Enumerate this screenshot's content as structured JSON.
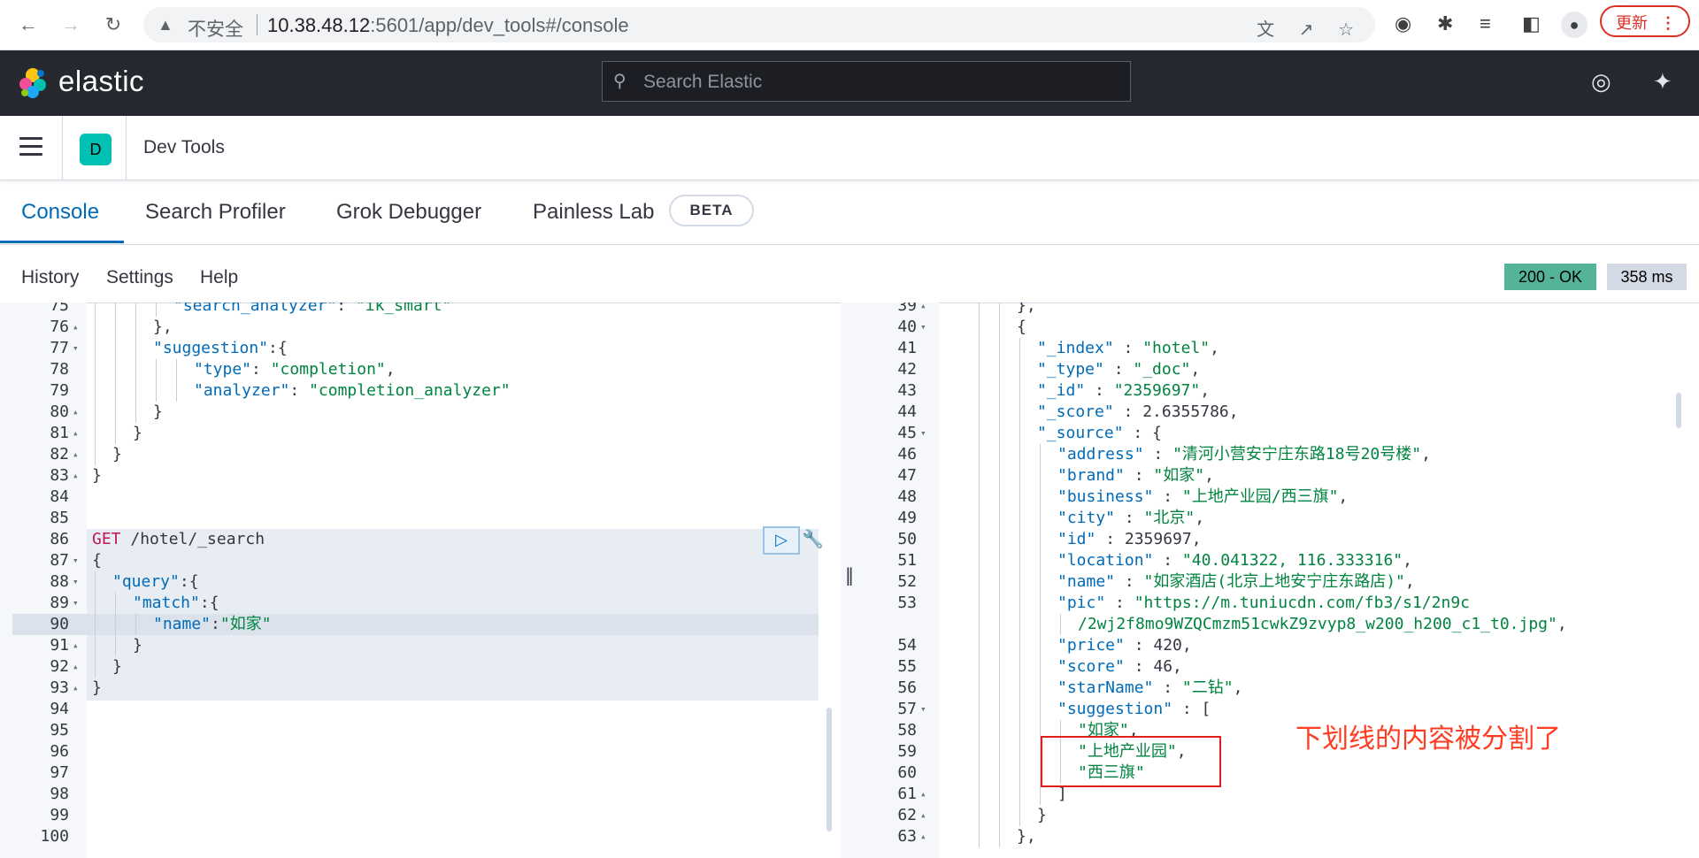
{
  "browser": {
    "insecure_label": "不安全",
    "url_host": "10.38.48.12",
    "url_rest": ":5601/app/dev_tools#/console",
    "update_button": "更新"
  },
  "header": {
    "brand": "elastic",
    "search_placeholder": "Search Elastic"
  },
  "breadcrumb": {
    "avatar_letter": "D",
    "app_title": "Dev Tools"
  },
  "tabs": [
    {
      "label": "Console",
      "active": true
    },
    {
      "label": "Search Profiler"
    },
    {
      "label": "Grok Debugger"
    },
    {
      "label": "Painless Lab"
    }
  ],
  "beta_badge": "BETA",
  "toolbar": {
    "history": "History",
    "settings": "Settings",
    "help": "Help",
    "status": "200 - OK",
    "time": "358 ms"
  },
  "request_editor": {
    "lines": [
      {
        "n": "75",
        "fold": "",
        "indent": 4,
        "parts": [
          [
            "k",
            "\"search_analyzer\""
          ],
          [
            "n",
            ": "
          ],
          [
            "s",
            "\"ik_smart\""
          ]
        ]
      },
      {
        "n": "76",
        "fold": "▴",
        "indent": 3,
        "parts": [
          [
            "n",
            "},"
          ]
        ]
      },
      {
        "n": "77",
        "fold": "▾",
        "indent": 3,
        "parts": [
          [
            "k",
            "\"suggestion\""
          ],
          [
            "n",
            ":{"
          ]
        ]
      },
      {
        "n": "78",
        "fold": "",
        "indent": 5,
        "parts": [
          [
            "k",
            "\"type\""
          ],
          [
            "n",
            ": "
          ],
          [
            "s",
            "\"completion\""
          ],
          [
            "n",
            ","
          ]
        ]
      },
      {
        "n": "79",
        "fold": "",
        "indent": 5,
        "parts": [
          [
            "k",
            "\"analyzer\""
          ],
          [
            "n",
            ": "
          ],
          [
            "s",
            "\"completion_analyzer\""
          ]
        ]
      },
      {
        "n": "80",
        "fold": "▴",
        "indent": 3,
        "parts": [
          [
            "n",
            "}"
          ]
        ]
      },
      {
        "n": "81",
        "fold": "▴",
        "indent": 2,
        "parts": [
          [
            "n",
            "}"
          ]
        ]
      },
      {
        "n": "82",
        "fold": "▴",
        "indent": 1,
        "parts": [
          [
            "n",
            "}"
          ]
        ]
      },
      {
        "n": "83",
        "fold": "▴",
        "indent": 0,
        "parts": [
          [
            "n",
            "}"
          ]
        ]
      },
      {
        "n": "84",
        "fold": "",
        "indent": 0,
        "parts": []
      },
      {
        "n": "85",
        "fold": "",
        "indent": 0,
        "parts": []
      },
      {
        "n": "86",
        "fold": "",
        "indent": 0,
        "parts": [
          [
            "verb",
            "GET"
          ],
          [
            "n",
            " /hotel/_search"
          ]
        ]
      },
      {
        "n": "87",
        "fold": "▾",
        "indent": 0,
        "parts": [
          [
            "n",
            "{"
          ]
        ]
      },
      {
        "n": "88",
        "fold": "▾",
        "indent": 1,
        "parts": [
          [
            "k",
            "\"query\""
          ],
          [
            "n",
            ":{"
          ]
        ]
      },
      {
        "n": "89",
        "fold": "▾",
        "indent": 2,
        "parts": [
          [
            "k",
            "\"match\""
          ],
          [
            "n",
            ":{"
          ]
        ]
      },
      {
        "n": "90",
        "fold": "",
        "indent": 3,
        "parts": [
          [
            "k",
            "\"name\""
          ],
          [
            "n",
            ":"
          ],
          [
            "s",
            "\"如家\""
          ]
        ]
      },
      {
        "n": "91",
        "fold": "▴",
        "indent": 2,
        "parts": [
          [
            "n",
            "}"
          ]
        ]
      },
      {
        "n": "92",
        "fold": "▴",
        "indent": 1,
        "parts": [
          [
            "n",
            "}"
          ]
        ]
      },
      {
        "n": "93",
        "fold": "▴",
        "indent": 0,
        "parts": [
          [
            "n",
            "}"
          ]
        ]
      },
      {
        "n": "94",
        "fold": "",
        "indent": 0,
        "parts": []
      },
      {
        "n": "95",
        "fold": "",
        "indent": 0,
        "parts": []
      },
      {
        "n": "96",
        "fold": "",
        "indent": 0,
        "parts": []
      },
      {
        "n": "97",
        "fold": "",
        "indent": 0,
        "parts": []
      },
      {
        "n": "98",
        "fold": "",
        "indent": 0,
        "parts": []
      },
      {
        "n": "99",
        "fold": "",
        "indent": 0,
        "parts": []
      },
      {
        "n": "100",
        "fold": "",
        "indent": 0,
        "parts": []
      }
    ]
  },
  "response_viewer": {
    "lines": [
      {
        "n": "39",
        "fold": "▴",
        "indent": 5,
        "parts": [
          [
            "n",
            "},"
          ]
        ]
      },
      {
        "n": "40",
        "fold": "▾",
        "indent": 5,
        "parts": [
          [
            "n",
            "{"
          ]
        ]
      },
      {
        "n": "41",
        "fold": "",
        "indent": 6,
        "parts": [
          [
            "k",
            "\"_index\""
          ],
          [
            "n",
            " : "
          ],
          [
            "s",
            "\"hotel\""
          ],
          [
            "n",
            ","
          ]
        ]
      },
      {
        "n": "42",
        "fold": "",
        "indent": 6,
        "parts": [
          [
            "k",
            "\"_type\""
          ],
          [
            "n",
            " : "
          ],
          [
            "s",
            "\"_doc\""
          ],
          [
            "n",
            ","
          ]
        ]
      },
      {
        "n": "43",
        "fold": "",
        "indent": 6,
        "parts": [
          [
            "k",
            "\"_id\""
          ],
          [
            "n",
            " : "
          ],
          [
            "s",
            "\"2359697\""
          ],
          [
            "n",
            ","
          ]
        ]
      },
      {
        "n": "44",
        "fold": "",
        "indent": 6,
        "parts": [
          [
            "k",
            "\"_score\""
          ],
          [
            "n",
            " : 2.6355786,"
          ]
        ]
      },
      {
        "n": "45",
        "fold": "▾",
        "indent": 6,
        "parts": [
          [
            "k",
            "\"_source\""
          ],
          [
            "n",
            " : {"
          ]
        ]
      },
      {
        "n": "46",
        "fold": "",
        "indent": 7,
        "parts": [
          [
            "k",
            "\"address\""
          ],
          [
            "n",
            " : "
          ],
          [
            "s",
            "\"清河小营安宁庄东路18号20号楼\""
          ],
          [
            "n",
            ","
          ]
        ]
      },
      {
        "n": "47",
        "fold": "",
        "indent": 7,
        "parts": [
          [
            "k",
            "\"brand\""
          ],
          [
            "n",
            " : "
          ],
          [
            "s",
            "\"如家\""
          ],
          [
            "n",
            ","
          ]
        ]
      },
      {
        "n": "48",
        "fold": "",
        "indent": 7,
        "parts": [
          [
            "k",
            "\"business\""
          ],
          [
            "n",
            " : "
          ],
          [
            "s",
            "\"上地产业园/西三旗\""
          ],
          [
            "n",
            ","
          ]
        ]
      },
      {
        "n": "49",
        "fold": "",
        "indent": 7,
        "parts": [
          [
            "k",
            "\"city\""
          ],
          [
            "n",
            " : "
          ],
          [
            "s",
            "\"北京\""
          ],
          [
            "n",
            ","
          ]
        ]
      },
      {
        "n": "50",
        "fold": "",
        "indent": 7,
        "parts": [
          [
            "k",
            "\"id\""
          ],
          [
            "n",
            " : 2359697,"
          ]
        ]
      },
      {
        "n": "51",
        "fold": "",
        "indent": 7,
        "parts": [
          [
            "k",
            "\"location\""
          ],
          [
            "n",
            " : "
          ],
          [
            "s",
            "\"40.041322, 116.333316\""
          ],
          [
            "n",
            ","
          ]
        ]
      },
      {
        "n": "52",
        "fold": "",
        "indent": 7,
        "parts": [
          [
            "k",
            "\"name\""
          ],
          [
            "n",
            " : "
          ],
          [
            "s",
            "\"如家酒店(北京上地安宁庄东路店)\""
          ],
          [
            "n",
            ","
          ]
        ]
      },
      {
        "n": "53",
        "fold": "",
        "indent": 7,
        "parts": [
          [
            "k",
            "\"pic\""
          ],
          [
            "n",
            " : "
          ],
          [
            "s",
            "\"https://m.tuniucdn.com/fb3/s1/2n9c"
          ]
        ]
      },
      {
        "n": "",
        "fold": "",
        "indent": 8,
        "parts": [
          [
            "s",
            "/2wj2f8mo9WZQCmzm51cwkZ9zvyp8_w200_h200_c1_t0.jpg\""
          ],
          [
            "n",
            ","
          ]
        ]
      },
      {
        "n": "54",
        "fold": "",
        "indent": 7,
        "parts": [
          [
            "k",
            "\"price\""
          ],
          [
            "n",
            " : 420,"
          ]
        ]
      },
      {
        "n": "55",
        "fold": "",
        "indent": 7,
        "parts": [
          [
            "k",
            "\"score\""
          ],
          [
            "n",
            " : 46,"
          ]
        ]
      },
      {
        "n": "56",
        "fold": "",
        "indent": 7,
        "parts": [
          [
            "k",
            "\"starName\""
          ],
          [
            "n",
            " : "
          ],
          [
            "s",
            "\"二钻\""
          ],
          [
            "n",
            ","
          ]
        ]
      },
      {
        "n": "57",
        "fold": "▾",
        "indent": 7,
        "parts": [
          [
            "k",
            "\"suggestion\""
          ],
          [
            "n",
            " : ["
          ]
        ]
      },
      {
        "n": "58",
        "fold": "",
        "indent": 8,
        "parts": [
          [
            "s",
            "\"如家\""
          ],
          [
            "n",
            ","
          ]
        ]
      },
      {
        "n": "59",
        "fold": "",
        "indent": 8,
        "parts": [
          [
            "s",
            "\"上地产业园\""
          ],
          [
            "n",
            ","
          ]
        ]
      },
      {
        "n": "60",
        "fold": "",
        "indent": 8,
        "parts": [
          [
            "s",
            "\"西三旗\""
          ]
        ]
      },
      {
        "n": "61",
        "fold": "▴",
        "indent": 7,
        "parts": [
          [
            "n",
            "]"
          ]
        ]
      },
      {
        "n": "62",
        "fold": "▴",
        "indent": 6,
        "parts": [
          [
            "n",
            "}"
          ]
        ]
      },
      {
        "n": "63",
        "fold": "▴",
        "indent": 5,
        "parts": [
          [
            "n",
            "},"
          ]
        ]
      }
    ]
  },
  "annotation": "下划线的内容被分割了"
}
